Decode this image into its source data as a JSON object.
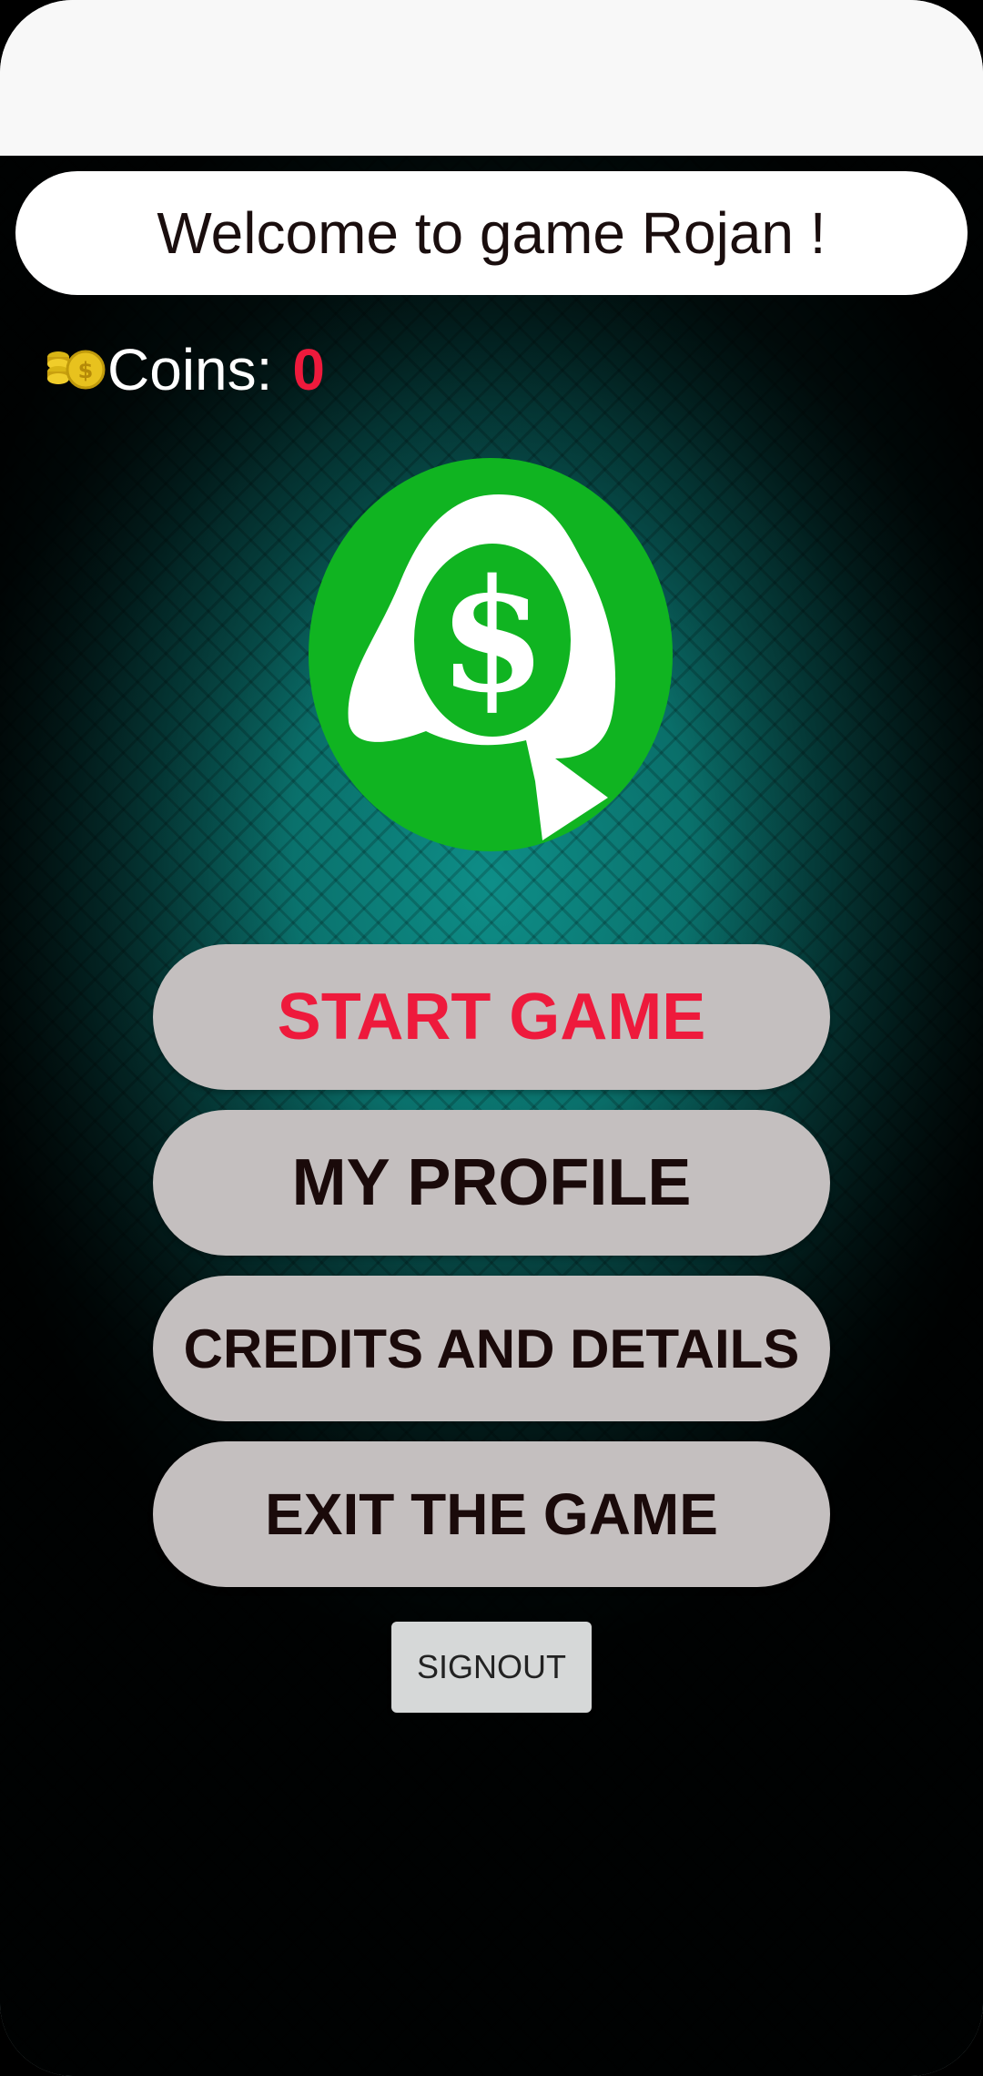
{
  "header": {
    "welcome_text": "Welcome to game Rojan !"
  },
  "coins": {
    "label": "Coins:",
    "value": "0",
    "icon": "gold-coins-icon"
  },
  "logo": {
    "icon": "spade-dollar-logo-icon",
    "symbol": "$"
  },
  "menu": {
    "start_label": "START GAME",
    "profile_label": "MY PROFILE",
    "credits_label": "CREDITS AND DETAILS",
    "exit_label": "EXIT THE GAME"
  },
  "signout_label": "SIGNOUT",
  "colors": {
    "accent_red": "#ee1a3c",
    "logo_green": "#10b421",
    "button_gray": "#c4bfbf",
    "background_teal": "#0a6f6a"
  }
}
